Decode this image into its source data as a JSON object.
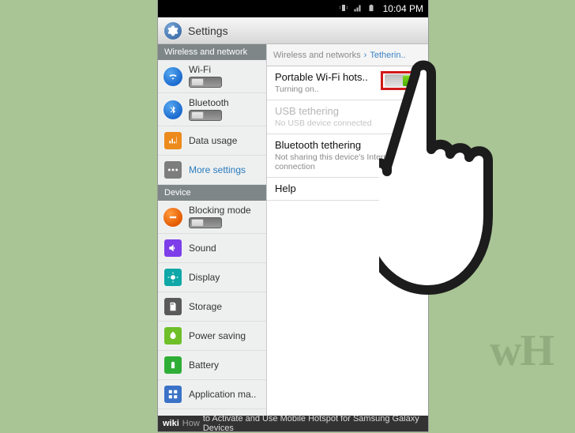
{
  "status": {
    "time": "10:04 PM"
  },
  "header": {
    "title": "Settings"
  },
  "sections": {
    "wireless": {
      "header": "Wireless and network"
    },
    "device": {
      "header": "Device"
    }
  },
  "left": {
    "wifi": {
      "label": "Wi-Fi"
    },
    "bluetooth": {
      "label": "Bluetooth"
    },
    "datausage": {
      "label": "Data usage"
    },
    "more": {
      "label": "More settings"
    },
    "blocking": {
      "label": "Blocking mode"
    },
    "sound": {
      "label": "Sound"
    },
    "display": {
      "label": "Display"
    },
    "storage": {
      "label": "Storage"
    },
    "power": {
      "label": "Power saving"
    },
    "battery": {
      "label": "Battery"
    },
    "appmgr": {
      "label": "Application ma.."
    }
  },
  "breadcrumb": {
    "root": "Wireless and networks",
    "sep": "›",
    "current": "Tetherin.."
  },
  "right": {
    "hotspot": {
      "title": "Portable Wi-Fi hots..",
      "sub": "Turning on..",
      "on": true
    },
    "usb": {
      "title": "USB tethering",
      "sub": "No USB device connected"
    },
    "bt": {
      "title": "Bluetooth tethering",
      "sub": "Not sharing this device's Internet connection"
    },
    "help": {
      "title": "Help"
    }
  },
  "caption": {
    "brand_a": "wiki",
    "brand_b": "How",
    "text": " to Activate and Use Mobile Hotspot for Samsung Galaxy Devices"
  },
  "watermark": "wH"
}
